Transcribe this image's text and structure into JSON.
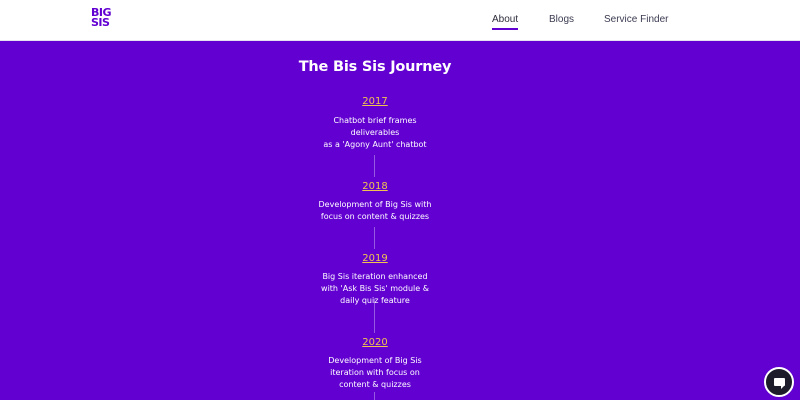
{
  "header": {
    "logo_line1": "BIG",
    "logo_line2": "SIS",
    "nav": [
      {
        "label": "About",
        "active": true
      },
      {
        "label": "Blogs",
        "active": false
      },
      {
        "label": "Service Finder",
        "active": false
      }
    ]
  },
  "main": {
    "title": "The Bis Sis Journey",
    "timeline": [
      {
        "year": "2017",
        "description": "Chatbot brief frames\ndeliverables\nas a 'Agony Aunt' chatbot"
      },
      {
        "year": "2018",
        "description": "Development of Big Sis with\nfocus on content & quizzes"
      },
      {
        "year": "2019",
        "description": "Big Sis iteration enhanced\nwith 'Ask Bis Sis' module &\ndaily quiz feature"
      },
      {
        "year": "2020",
        "description": "Development of Big Sis\niteration with focus on\ncontent & quizzes"
      }
    ]
  },
  "chat": {
    "icon": "chat-bubble-icon"
  },
  "colors": {
    "brand": "#6200d2",
    "year": "#f0c44e",
    "header_bg": "#ffffff"
  }
}
